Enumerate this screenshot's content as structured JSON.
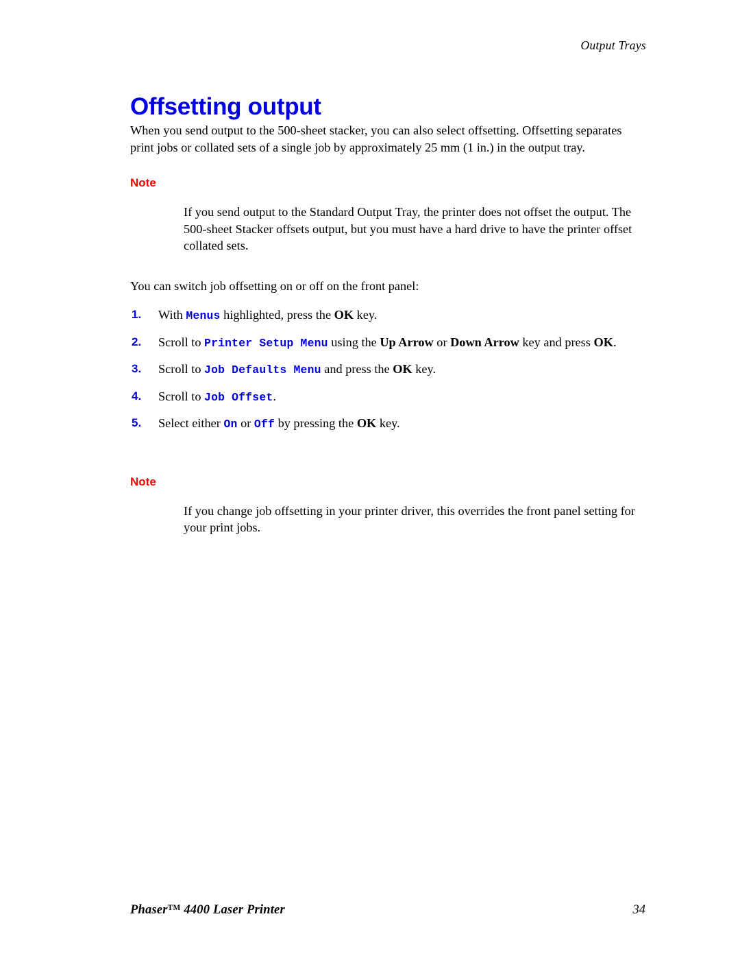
{
  "header": {
    "running_title": "Output Trays"
  },
  "title": "Offsetting output",
  "intro": "When you send output to the 500-sheet stacker, you can also select offsetting. Offsetting separates print jobs or collated sets of a single job by approximately 25 mm (1 in.) in the output tray.",
  "note1": {
    "label": "Note",
    "body": "If you send output to the Standard Output Tray, the printer does not offset the output. The 500-sheet Stacker offsets output, but you must have a hard drive to have the printer offset collated sets."
  },
  "lead_in": "You can switch job offsetting on or off on the front panel:",
  "steps": [
    {
      "number": "1.",
      "part1": "With ",
      "code1": "Menus",
      "part2": " highlighted, press the ",
      "kbd1": "OK",
      "part3": " key."
    },
    {
      "number": "2.",
      "part1": "Scroll to ",
      "code1": "Printer Setup Menu",
      "part2": " using the ",
      "kbd1": "Up Arrow",
      "part3": " or ",
      "kbd2": "Down Arrow",
      "part4": " key and press ",
      "kbd3": "OK",
      "part5": "."
    },
    {
      "number": "3.",
      "part1": "Scroll to ",
      "code1": "Job Defaults Menu",
      "part2": " and press the ",
      "kbd1": "OK",
      "part3": " key."
    },
    {
      "number": "4.",
      "part1": "Scroll to ",
      "code1": "Job Offset",
      "part2": "."
    },
    {
      "number": "5.",
      "part1": "Select either ",
      "code1": "On",
      "part2": " or ",
      "code2": "Off",
      "part3": " by pressing the ",
      "kbd1": "OK",
      "part4": " key."
    }
  ],
  "note2": {
    "label": "Note",
    "body": "If you change job offsetting in your printer driver, this overrides the front panel setting for your print jobs."
  },
  "footer": {
    "product_name": "Phaser",
    "trademark": "TM",
    "product_model": " 4400 Laser Printer",
    "page_number": "34"
  },
  "colors": {
    "title_blue": "#0000e0",
    "note_red": "#ff0000",
    "code_blue": "#0000e0",
    "text_black": "#000000",
    "page_background": "#ffffff"
  }
}
